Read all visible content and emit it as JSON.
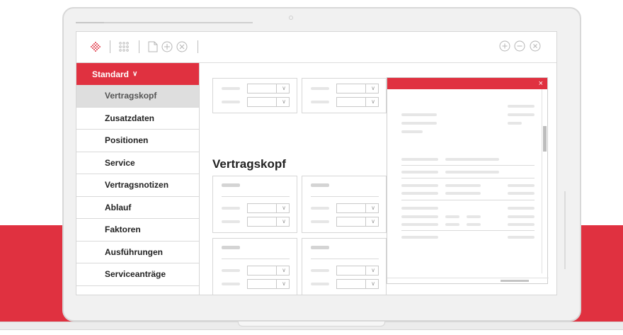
{
  "colors": {
    "accent": "#e03140",
    "sidebar_active": "#dedede",
    "border": "#d6d6d6"
  },
  "toolbar": {
    "icons": [
      "logo-diamond-icon",
      "apps-grid-icon",
      "new-document-icon",
      "add-circle-icon",
      "close-circle-icon"
    ],
    "window_controls": [
      "maximize-icon",
      "minimize-icon",
      "close-icon"
    ]
  },
  "sidebar": {
    "header": "Standard",
    "items": [
      {
        "label": "Vertragskopf",
        "active": true
      },
      {
        "label": "Zusatzdaten"
      },
      {
        "label": "Positionen"
      },
      {
        "label": "Service"
      },
      {
        "label": "Vertragsnotizen"
      },
      {
        "label": "Ablauf"
      },
      {
        "label": "Faktoren"
      },
      {
        "label": "Ausführungen"
      },
      {
        "label": "Serviceanträge"
      }
    ]
  },
  "main": {
    "section_title": "Vertragskopf"
  },
  "modal": {
    "close_glyph": "×"
  }
}
